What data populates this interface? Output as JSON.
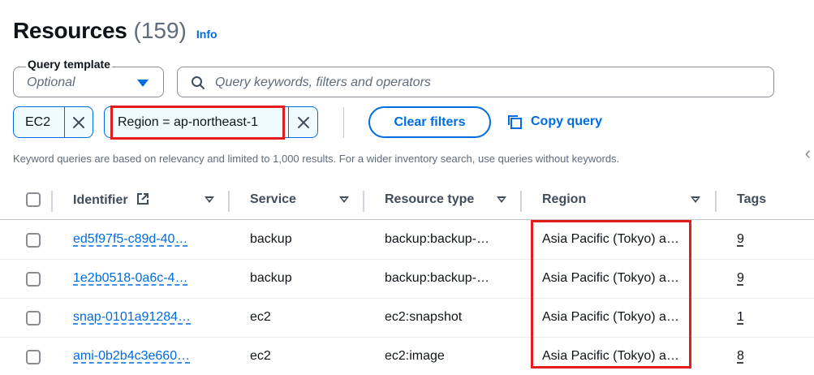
{
  "header": {
    "title": "Resources",
    "count": "(159)",
    "info_label": "Info"
  },
  "query_template": {
    "label": "Query template",
    "placeholder": "Optional"
  },
  "search": {
    "placeholder": "Query keywords, filters and operators"
  },
  "filters": [
    {
      "label": "EC2"
    },
    {
      "label": "Region = ap-northeast-1"
    }
  ],
  "actions": {
    "clear_filters": "Clear filters",
    "copy_query": "Copy query"
  },
  "note": "Keyword queries are based on relevancy and limited to 1,000 results. For a wider inventory search, use queries without keywords.",
  "table": {
    "columns": [
      "Identifier",
      "Service",
      "Resource type",
      "Region",
      "Tags"
    ],
    "rows": [
      {
        "identifier": "ed5f97f5-c89d-40…",
        "service": "backup",
        "resource_type": "backup:backup-…",
        "region": "Asia Pacific (Tokyo) a…",
        "tags": "9"
      },
      {
        "identifier": "1e2b0518-0a6c-4…",
        "service": "backup",
        "resource_type": "backup:backup-…",
        "region": "Asia Pacific (Tokyo) a…",
        "tags": "9"
      },
      {
        "identifier": "snap-0101a91284…",
        "service": "ec2",
        "resource_type": "ec2:snapshot",
        "region": "Asia Pacific (Tokyo) a…",
        "tags": "1"
      },
      {
        "identifier": "ami-0b2b4c3e660…",
        "service": "ec2",
        "resource_type": "ec2:image",
        "region": "Asia Pacific (Tokyo) a…",
        "tags": "8"
      }
    ]
  },
  "colors": {
    "accent": "#006ce0",
    "highlight": "#e51c1c",
    "text": "#0f141a",
    "muted": "#5f6b7a"
  },
  "icons": [
    "search-icon",
    "close-icon",
    "copy-icon",
    "external-link-icon",
    "sort-caret-icon",
    "chevron-left-icon",
    "caret-down-icon"
  ]
}
